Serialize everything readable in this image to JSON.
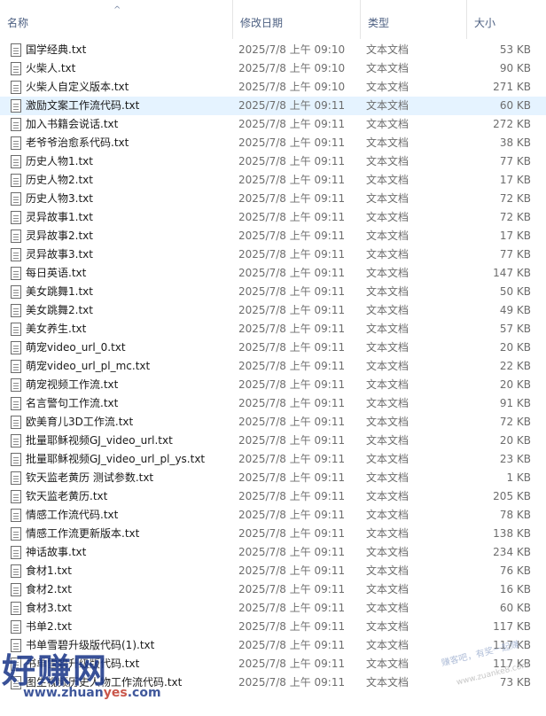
{
  "header": {
    "name": "名称",
    "date": "修改日期",
    "type": "类型",
    "size": "大小",
    "sort_arrow": "^"
  },
  "files": [
    {
      "name": "国学经典.txt",
      "date": "2025/7/8 上午 09:10",
      "type": "文本文档",
      "size": "53 KB"
    },
    {
      "name": "火柴人.txt",
      "date": "2025/7/8 上午 09:10",
      "type": "文本文档",
      "size": "90 KB"
    },
    {
      "name": "火柴人自定义版本.txt",
      "date": "2025/7/8 上午 09:10",
      "type": "文本文档",
      "size": "271 KB"
    },
    {
      "name": "激励文案工作流代码.txt",
      "date": "2025/7/8 上午 09:11",
      "type": "文本文档",
      "size": "60 KB",
      "state": "hover"
    },
    {
      "name": "加入书籍会说话.txt",
      "date": "2025/7/8 上午 09:11",
      "type": "文本文档",
      "size": "272 KB"
    },
    {
      "name": "老爷爷治愈系代码.txt",
      "date": "2025/7/8 上午 09:11",
      "type": "文本文档",
      "size": "38 KB"
    },
    {
      "name": "历史人物1.txt",
      "date": "2025/7/8 上午 09:11",
      "type": "文本文档",
      "size": "77 KB"
    },
    {
      "name": "历史人物2.txt",
      "date": "2025/7/8 上午 09:11",
      "type": "文本文档",
      "size": "17 KB"
    },
    {
      "name": "历史人物3.txt",
      "date": "2025/7/8 上午 09:11",
      "type": "文本文档",
      "size": "72 KB"
    },
    {
      "name": "灵异故事1.txt",
      "date": "2025/7/8 上午 09:11",
      "type": "文本文档",
      "size": "72 KB"
    },
    {
      "name": "灵异故事2.txt",
      "date": "2025/7/8 上午 09:11",
      "type": "文本文档",
      "size": "17 KB"
    },
    {
      "name": "灵异故事3.txt",
      "date": "2025/7/8 上午 09:11",
      "type": "文本文档",
      "size": "77 KB"
    },
    {
      "name": "每日英语.txt",
      "date": "2025/7/8 上午 09:11",
      "type": "文本文档",
      "size": "147 KB"
    },
    {
      "name": "美女跳舞1.txt",
      "date": "2025/7/8 上午 09:11",
      "type": "文本文档",
      "size": "50 KB"
    },
    {
      "name": "美女跳舞2.txt",
      "date": "2025/7/8 上午 09:11",
      "type": "文本文档",
      "size": "49 KB"
    },
    {
      "name": "美女养生.txt",
      "date": "2025/7/8 上午 09:11",
      "type": "文本文档",
      "size": "57 KB"
    },
    {
      "name": "萌宠video_url_0.txt",
      "date": "2025/7/8 上午 09:11",
      "type": "文本文档",
      "size": "20 KB"
    },
    {
      "name": "萌宠video_url_pl_mc.txt",
      "date": "2025/7/8 上午 09:11",
      "type": "文本文档",
      "size": "22 KB"
    },
    {
      "name": "萌宠视频工作流.txt",
      "date": "2025/7/8 上午 09:11",
      "type": "文本文档",
      "size": "20 KB"
    },
    {
      "name": "名言警句工作流.txt",
      "date": "2025/7/8 上午 09:11",
      "type": "文本文档",
      "size": "91 KB"
    },
    {
      "name": "欧美育儿3D工作流.txt",
      "date": "2025/7/8 上午 09:11",
      "type": "文本文档",
      "size": "72 KB"
    },
    {
      "name": "批量耶稣视频GJ_video_url.txt",
      "date": "2025/7/8 上午 09:11",
      "type": "文本文档",
      "size": "20 KB"
    },
    {
      "name": "批量耶稣视频GJ_video_url_pl_ys.txt",
      "date": "2025/7/8 上午 09:11",
      "type": "文本文档",
      "size": "23 KB"
    },
    {
      "name": "钦天监老黄历 测试参数.txt",
      "date": "2025/7/8 上午 09:11",
      "type": "文本文档",
      "size": "1 KB"
    },
    {
      "name": "钦天监老黄历.txt",
      "date": "2025/7/8 上午 09:11",
      "type": "文本文档",
      "size": "205 KB"
    },
    {
      "name": "情感工作流代码.txt",
      "date": "2025/7/8 上午 09:11",
      "type": "文本文档",
      "size": "78 KB"
    },
    {
      "name": "情感工作流更新版本.txt",
      "date": "2025/7/8 上午 09:11",
      "type": "文本文档",
      "size": "138 KB"
    },
    {
      "name": "神话故事.txt",
      "date": "2025/7/8 上午 09:11",
      "type": "文本文档",
      "size": "234 KB"
    },
    {
      "name": "食材1.txt",
      "date": "2025/7/8 上午 09:11",
      "type": "文本文档",
      "size": "76 KB"
    },
    {
      "name": "食材2.txt",
      "date": "2025/7/8 上午 09:11",
      "type": "文本文档",
      "size": "16 KB"
    },
    {
      "name": "食材3.txt",
      "date": "2025/7/8 上午 09:11",
      "type": "文本文档",
      "size": "60 KB"
    },
    {
      "name": "书单2.txt",
      "date": "2025/7/8 上午 09:11",
      "type": "文本文档",
      "size": "117 KB"
    },
    {
      "name": "书单雪碧升级版代码(1).txt",
      "date": "2025/7/8 上午 09:11",
      "type": "文本文档",
      "size": "117 KB"
    },
    {
      "name": "书单雪碧升级版代码.txt",
      "date": "2025/7/8 上午 09:11",
      "type": "文本文档",
      "size": "117 KB"
    },
    {
      "name": "图生视频历史人物工作流代码.txt",
      "date": "2025/7/8 上午 09:11",
      "type": "文本文档",
      "size": "73 KB"
    }
  ],
  "watermark": {
    "logo": "好赚网",
    "url_prefix": "www.zhuan",
    "url_accent": "yes",
    "url_suffix": ".com",
    "slogan": "赚客吧，有奖一起赚",
    "site": "www.zuanke8.com"
  }
}
